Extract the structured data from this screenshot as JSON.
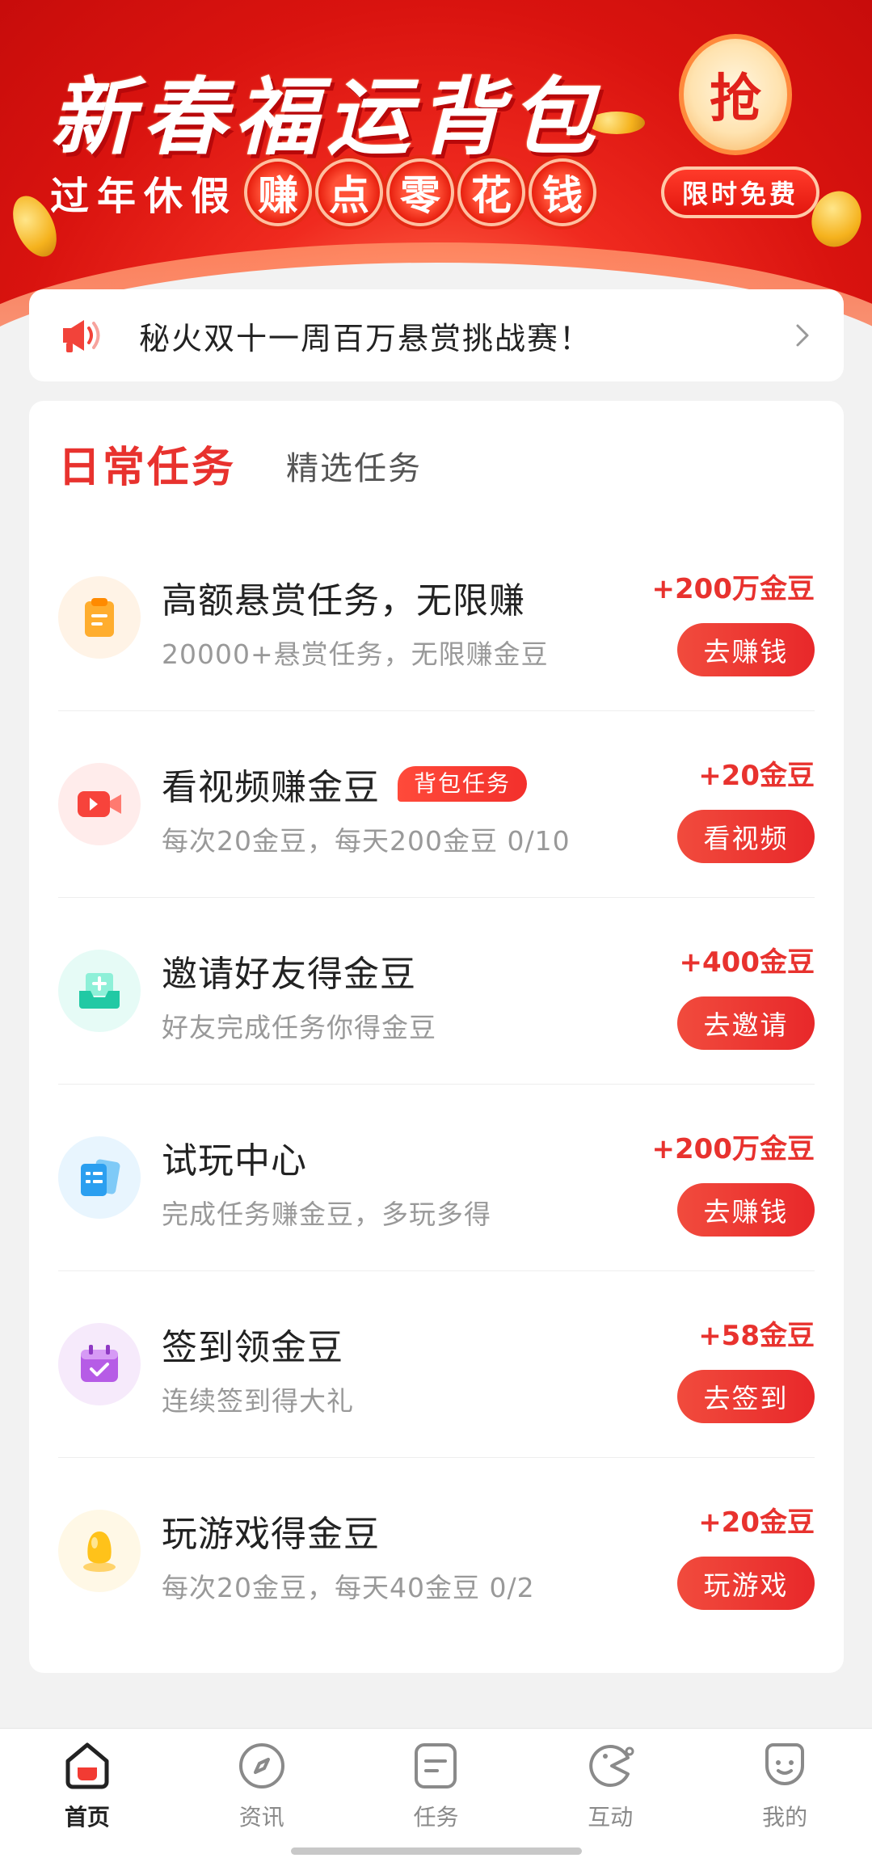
{
  "banner": {
    "title": "新春福运背包",
    "subtitle_plain": "过年休假",
    "subtitle_bubbles": [
      "赚",
      "点",
      "零",
      "花",
      "钱"
    ],
    "grab_label": "抢",
    "limit_label": "限时免费"
  },
  "notice": {
    "text": "秘火双十一周百万悬赏挑战赛！",
    "icon": "megaphone-icon"
  },
  "tabs": {
    "active": "日常任务",
    "other": "精选任务"
  },
  "tasks": [
    {
      "title": "高额悬赏任务，无限赚",
      "badge": "",
      "desc": "20000+悬赏任务，无限赚金豆",
      "reward": "+200万金豆",
      "button": "去赚钱",
      "icon": "clipboard-icon",
      "icon_bg": "#fff3e6"
    },
    {
      "title": "看视频赚金豆",
      "badge": "背包任务",
      "desc": "每次20金豆，每天200金豆 0/10",
      "reward": "+20金豆",
      "button": "看视频",
      "icon": "video-camera-icon",
      "icon_bg": "#ffeceb"
    },
    {
      "title": "邀请好友得金豆",
      "badge": "",
      "desc": "好友完成任务你得金豆",
      "reward": "+400金豆",
      "button": "去邀请",
      "icon": "invite-inbox-icon",
      "icon_bg": "#e6fbf6"
    },
    {
      "title": "试玩中心",
      "badge": "",
      "desc": "完成任务赚金豆，多玩多得",
      "reward": "+200万金豆",
      "button": "去赚钱",
      "icon": "cards-icon",
      "icon_bg": "#e8f5fe"
    },
    {
      "title": "签到领金豆",
      "badge": "",
      "desc": "连续签到得大礼",
      "reward": "+58金豆",
      "button": "去签到",
      "icon": "calendar-check-icon",
      "icon_bg": "#f6eafb"
    },
    {
      "title": "玩游戏得金豆",
      "badge": "",
      "desc": "每次20金豆，每天40金豆 0/2",
      "reward": "+20金豆",
      "button": "玩游戏",
      "icon": "egg-icon",
      "icon_bg": "#fff8e6"
    }
  ],
  "nav": [
    {
      "label": "首页",
      "icon": "home-icon",
      "active": true
    },
    {
      "label": "资讯",
      "icon": "compass-icon",
      "active": false
    },
    {
      "label": "任务",
      "icon": "task-icon",
      "active": false
    },
    {
      "label": "互动",
      "icon": "interact-icon",
      "active": false
    },
    {
      "label": "我的",
      "icon": "profile-icon",
      "active": false
    }
  ],
  "colors": {
    "accent": "#e8322e",
    "banner_red": "#d9130f"
  }
}
